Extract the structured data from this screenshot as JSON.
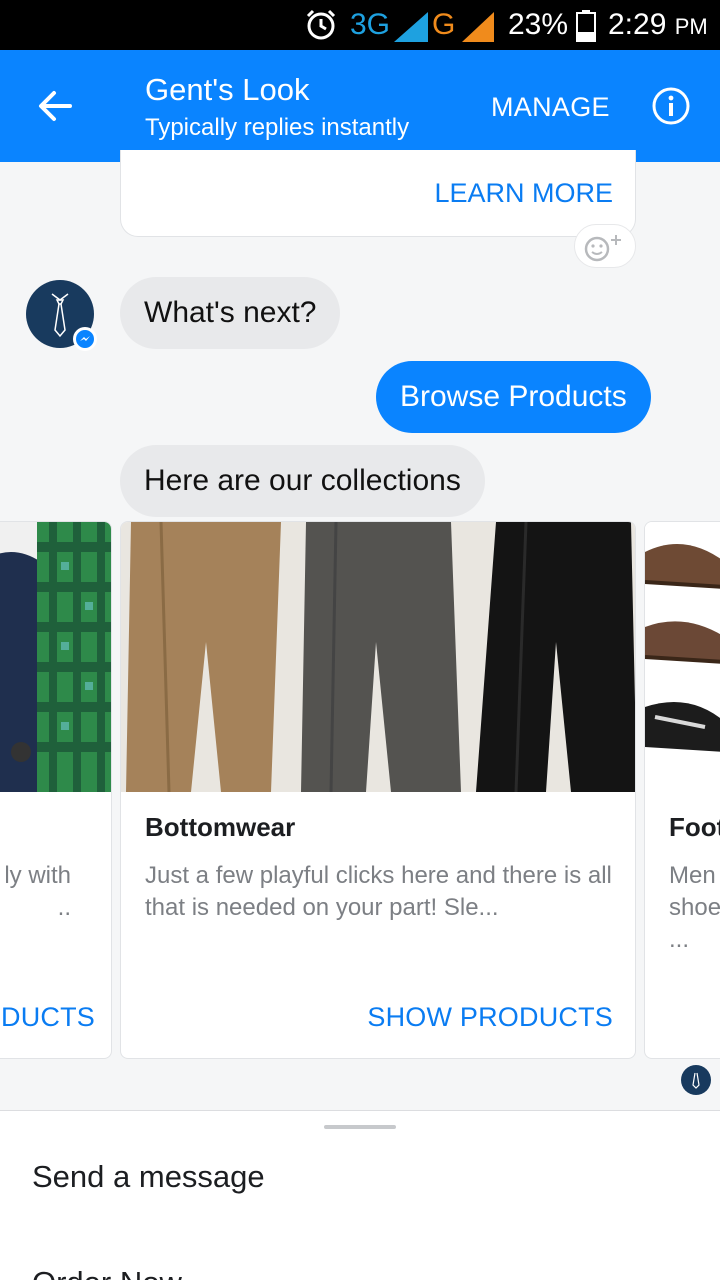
{
  "status_bar": {
    "alarm_icon": "alarm-icon",
    "network_3g": "3G",
    "network_g": "G",
    "battery": "23%",
    "time": "2:29",
    "ampm": "PM"
  },
  "header": {
    "title": "Gent's Look",
    "subtitle": "Typically replies instantly",
    "manage_label": "MANAGE",
    "bg_color": "#0a84ff"
  },
  "previous_card": {
    "button_label": "LEARN MORE"
  },
  "messages": [
    {
      "from": "page",
      "text": "What's next?"
    },
    {
      "from": "user",
      "text": "Browse Products"
    },
    {
      "from": "page",
      "text": "Here are our collections"
    }
  ],
  "carousel": {
    "left_card": {
      "desc_line1": "ly with",
      "desc_line2": "..",
      "button": "DUCTS"
    },
    "main_card": {
      "title": "Bottomwear",
      "desc": "Just a few playful clicks here and there is all that is needed on your part! Sle...",
      "button": "SHOW PRODUCTS"
    },
    "right_card": {
      "title": "Foot",
      "desc_line1": "Men",
      "desc_line2": "shoe",
      "desc_line3": "..."
    }
  },
  "quick_menu": {
    "items": [
      "Send a message",
      "Order Now"
    ]
  }
}
